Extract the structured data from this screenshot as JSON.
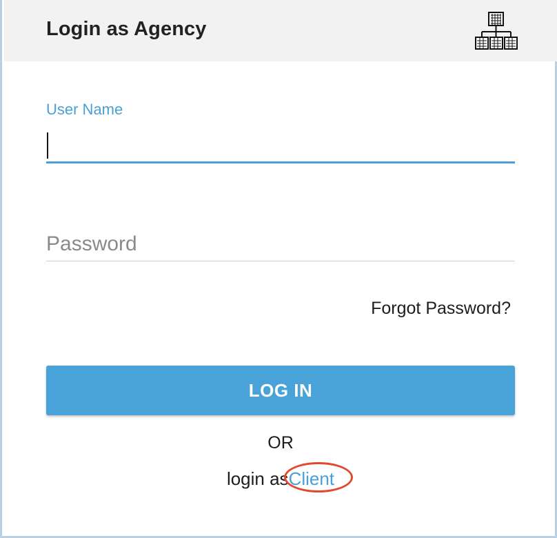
{
  "header": {
    "title": "Login as Agency",
    "icon": "organization-chart-icon"
  },
  "form": {
    "username_label": "User Name",
    "username_value": "",
    "password_placeholder": "Password",
    "password_value": "",
    "forgot_password": "Forgot Password?",
    "login_button": "LOG IN",
    "or_text": "OR",
    "alt_login_prefix": "login as",
    "alt_login_link": "Client"
  },
  "colors": {
    "accent": "#4aa3d8",
    "header_bg": "#f2f2f2",
    "highlight_ring": "#e04a2f"
  }
}
